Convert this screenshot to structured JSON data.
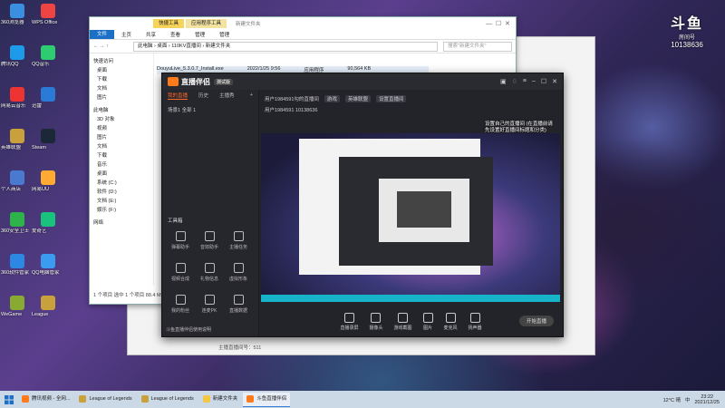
{
  "desktop_icons": [
    {
      "label": "360浏览器",
      "color": "#3b8fe0"
    },
    {
      "label": "腾讯QQ",
      "color": "#1e9be8"
    },
    {
      "label": "网易云音乐",
      "color": "#e33"
    },
    {
      "label": "英雄联盟",
      "color": "#c9a13c"
    },
    {
      "label": "个人商店",
      "color": "#4a7ad0"
    },
    {
      "label": "360安全卫士",
      "color": "#2db34a"
    },
    {
      "label": "360软件管家",
      "color": "#2c88e0"
    },
    {
      "label": "WeGame",
      "color": "#8a3"
    },
    {
      "label": "WPS Office",
      "color": "#e44"
    },
    {
      "label": "QQ音乐",
      "color": "#2ecc71"
    },
    {
      "label": "迅雷",
      "color": "#2a7ad6"
    },
    {
      "label": "Steam",
      "color": "#1b2838"
    },
    {
      "label": "网易UU",
      "color": "#fa3"
    },
    {
      "label": "爱奇艺",
      "color": "#19c37d"
    },
    {
      "label": "QQ电脑管家",
      "color": "#3b9bf0"
    },
    {
      "label": "League",
      "color": "#c9a13c"
    }
  ],
  "explorer": {
    "tools_tab": "快捷工具",
    "apptools_tab": "应用程序工具",
    "title": "新建文件夹",
    "ribbon": [
      "文件",
      "主页",
      "共享",
      "查看",
      "管理",
      "管理"
    ],
    "path": "此电脑 › 桌面 › 110KV直播间 › 新建文件夹",
    "search_placeholder": "搜索\"新建文件夹\"",
    "sidebar": [
      "快速访问",
      "桌面",
      "下载",
      "文档",
      "图片",
      "此电脑",
      "3D 对象",
      "视频",
      "图片",
      "文档",
      "下载",
      "音乐",
      "桌面",
      "系统 (C:)",
      "软件 (D:)",
      "文档 (E:)",
      "娱乐 (F:)",
      "网络"
    ],
    "file": {
      "name": "DouyuLive_5.3.0.7_Install.exe",
      "date": "2022/1/25 9:56",
      "type": "应用程序",
      "size": "90,564 KB"
    },
    "status": "1 个项目    选中 1 个项目 88.4 MB"
  },
  "graywin": {
    "status": "主播直播间号：511"
  },
  "app": {
    "logo": "直播伴侣",
    "version": "测试版",
    "left_tabs": [
      "我的直播",
      "历史",
      "主播秀"
    ],
    "scene": "场景1   全部 1",
    "tools_title": "工具箱",
    "tools": [
      "弹幕助手",
      "音效助手",
      "主播任务",
      "视频合成",
      "礼物信息",
      "虚拟形象",
      "我的粉丝",
      "连麦PK",
      "直播数据"
    ],
    "bottom_note": "斗鱼直播伴侣使用说明",
    "room_title": "用户1984591勾的直播间",
    "room_tags": [
      "游戏",
      "英雄联盟",
      "设置直播间"
    ],
    "room_meta": "用户1984591  10138636",
    "controls": [
      "直播录屏",
      "摄像头",
      "游戏截图",
      "图片",
      "麦克风",
      "扬声器"
    ],
    "go_live": "开始直播"
  },
  "right_overlay": "设置自己的直播间 (在直播前请先设置好直播间标题和分类)",
  "douyu": {
    "logo": "斗鱼",
    "sub": "房间号",
    "room": "10138636"
  },
  "taskbar": {
    "items": [
      {
        "label": "腾讯视频 - 全网...",
        "color": "#ff7a1a",
        "active": false
      },
      {
        "label": "League of Legends",
        "color": "#c9a13c",
        "active": false
      },
      {
        "label": "League of Legends",
        "color": "#c9a13c",
        "active": false
      },
      {
        "label": "新建文件夹",
        "color": "#f3c744",
        "active": false
      },
      {
        "label": "斗鱼直播伴侣",
        "color": "#ff7a1a",
        "active": true
      }
    ],
    "weather": "12°C 晴",
    "lang": "中",
    "time": "23:22",
    "date": "2021/12/25"
  }
}
